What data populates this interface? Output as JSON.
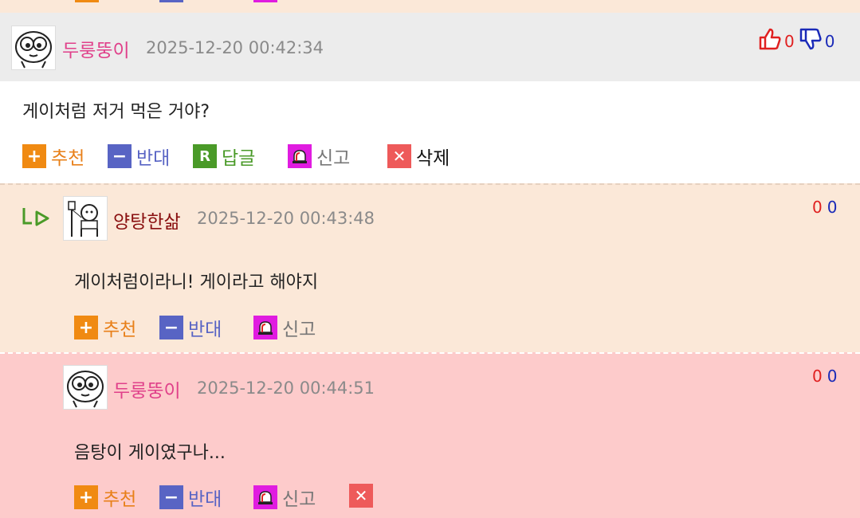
{
  "comment": {
    "nickname": "두룽뚱이",
    "datetime": "2025-12-20 00:42:34",
    "text": "게이처럼 저거 먹은 거야?",
    "up_count": "0",
    "down_count": "0",
    "actions": {
      "recommend": "추천",
      "oppose": "반대",
      "reply": "답글",
      "report": "신고",
      "delete": "삭제"
    }
  },
  "replies": [
    {
      "nickname": "양탕한삶",
      "datetime": "2025-12-20 00:43:48",
      "text": "게이처럼이라니! 게이라고 해야지",
      "up_count": "0",
      "down_count": "0",
      "actions": {
        "recommend": "추천",
        "oppose": "반대",
        "report": "신고"
      }
    },
    {
      "nickname": "두룽뚱이",
      "datetime": "2025-12-20 00:44:51",
      "text": "음탕이 게이였구나...",
      "up_count": "0",
      "down_count": "0",
      "actions": {
        "recommend": "추천",
        "oppose": "반대",
        "report": "신고"
      }
    }
  ],
  "colors": {
    "nick_pink": "#e0408a",
    "nick_darkred": "#8a1010",
    "reply_bg": "#fbe8d8",
    "reply2_bg": "#fdcbcb",
    "header_bg": "#ececec"
  }
}
